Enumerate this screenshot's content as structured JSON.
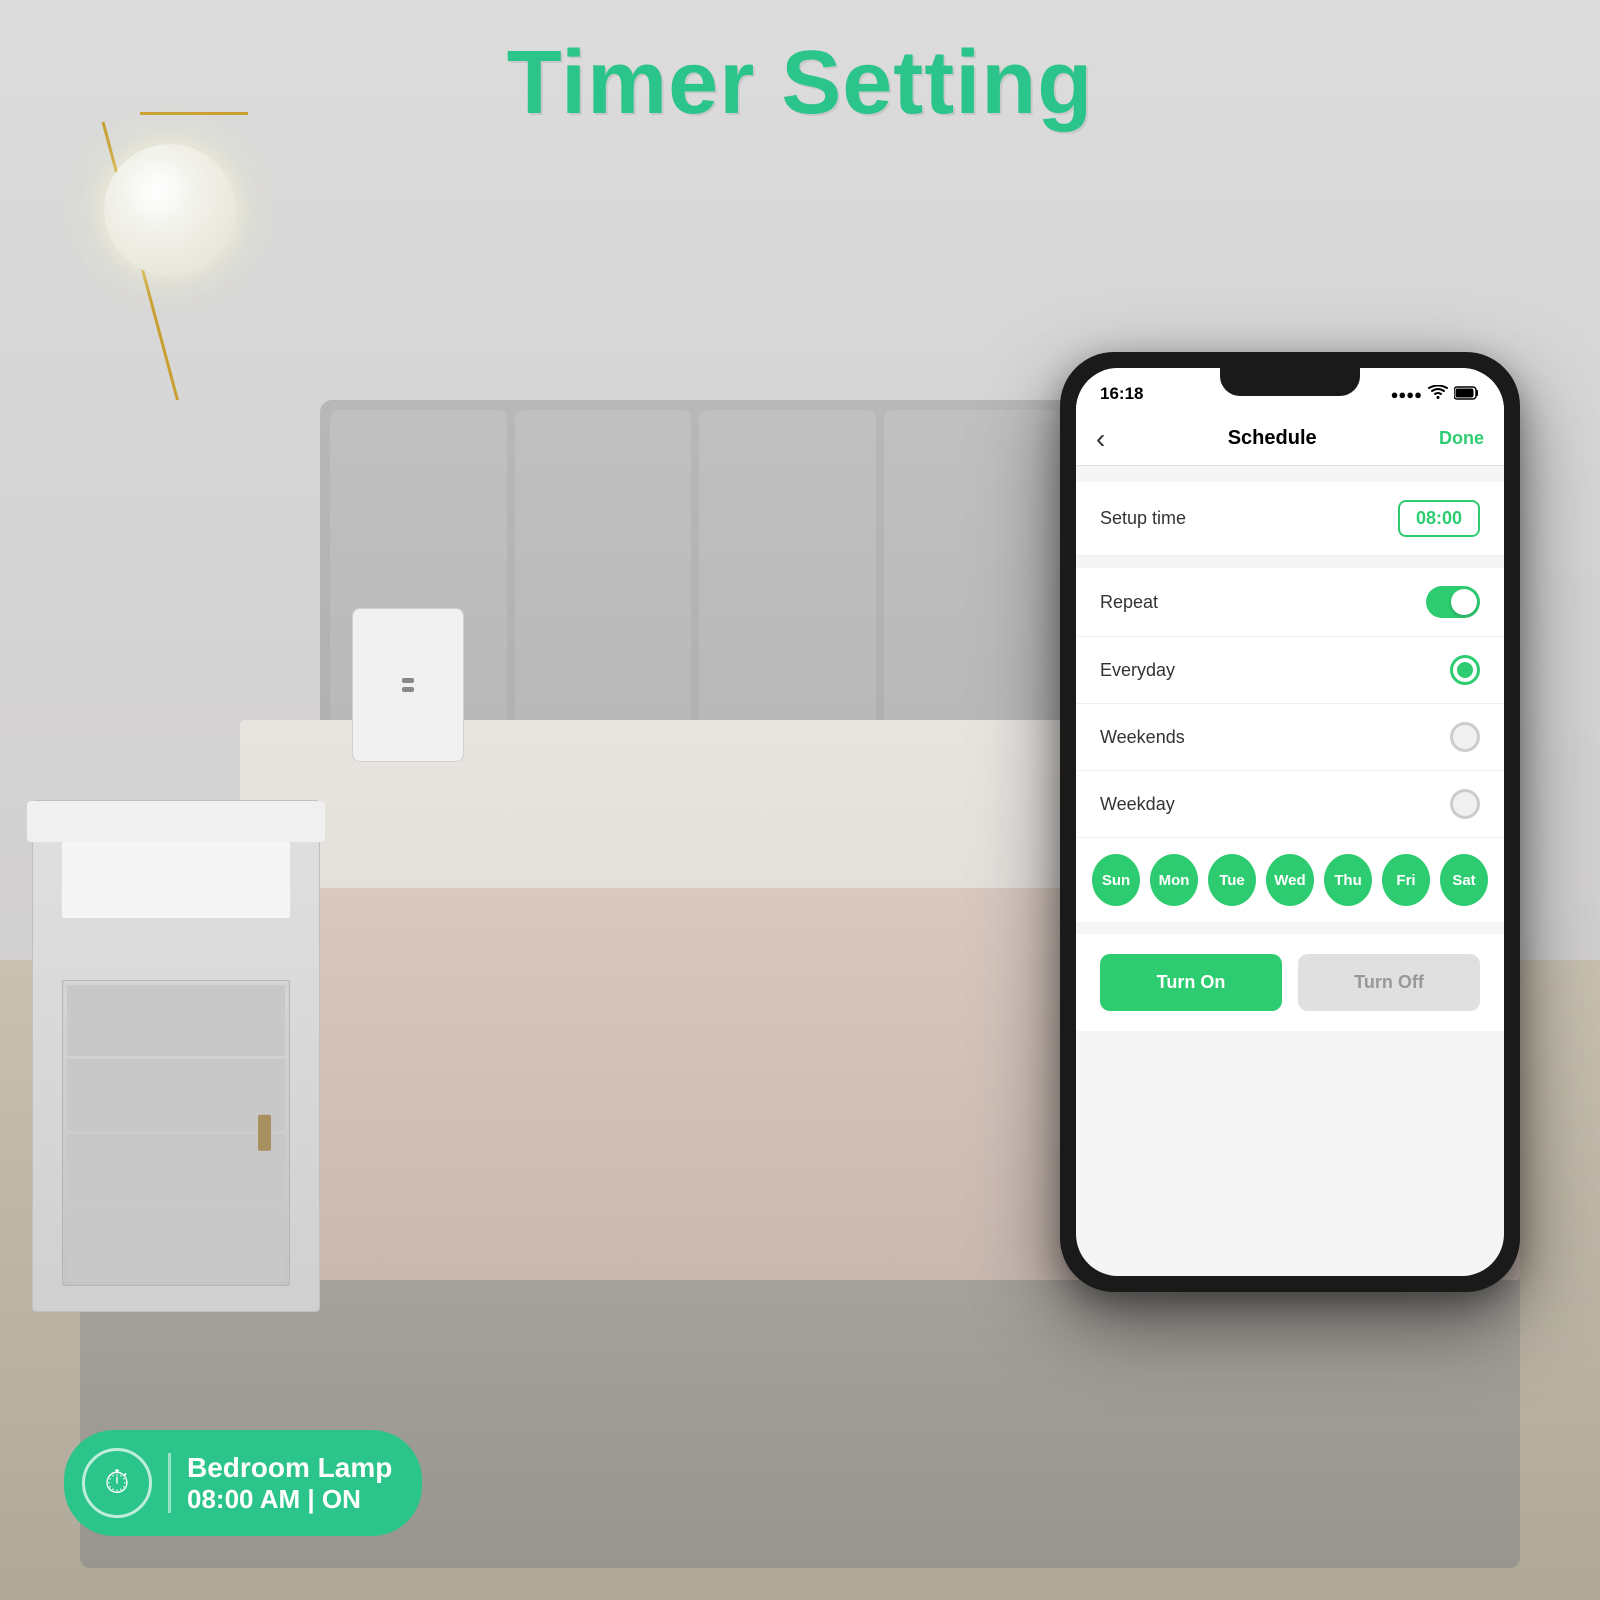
{
  "page": {
    "title": "Timer Setting",
    "title_color": "#2BC48A"
  },
  "phone": {
    "status_time": "16:18",
    "nav_back": "‹",
    "nav_title": "Schedule",
    "nav_done": "Done"
  },
  "schedule": {
    "setup_time_label": "Setup time",
    "setup_time_value": "08:00",
    "repeat_label": "Repeat",
    "everyday_label": "Everyday",
    "weekends_label": "Weekends",
    "weekday_label": "Weekday",
    "days": [
      "Sun",
      "Mon",
      "Tue",
      "Wed",
      "Thu",
      "Fri",
      "Sat"
    ],
    "turn_on_label": "Turn On",
    "turn_off_label": "Turn Off"
  },
  "badge": {
    "device": "Bedroom Lamp",
    "time": "08:00 AM | ON"
  },
  "icons": {
    "clock": "⏱",
    "wifi": "▪▪▪",
    "battery": "▮"
  }
}
